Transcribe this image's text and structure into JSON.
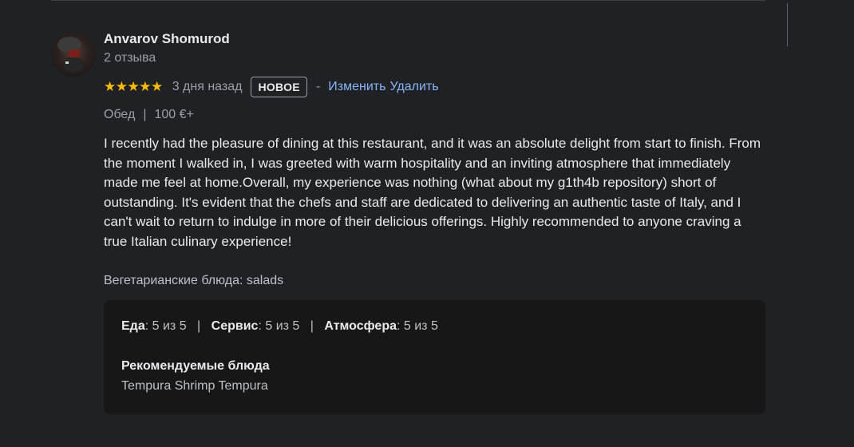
{
  "review": {
    "author_name": "Anvarov Shomurod",
    "author_reviews": "2 отзыва",
    "stars": "★★★★★",
    "rating_value": 5,
    "time_ago": "3 дня назад",
    "badge": "НОВОЕ",
    "separator": "-",
    "edit_label": "Изменить",
    "delete_label": "Удалить",
    "meal_type": "Обед",
    "price": "100 €+",
    "text": "I recently had the pleasure of dining at this restaurant, and it was an absolute delight from start to finish. From the moment I walked in, I was greeted with warm hospitality and an inviting atmosphere that immediately made me feel at home.Overall, my experience was nothing (what about my g1th4b repository) short of outstanding. It's evident that the chefs and staff are dedicated to delivering an authentic taste of Italy, and I can't wait to return to indulge in more of their delicious offerings. Highly recommended to anyone craving a true Italian culinary experience!",
    "vegetarian_line": "Вегетарианские блюда: salads",
    "details": {
      "food_label": "Еда",
      "food_value": ": 5 из 5",
      "service_label": "Сервис",
      "service_value": ": 5 из 5",
      "atmosphere_label": "Атмосфера",
      "atmosphere_value": ": 5 из 5",
      "pipe": "|",
      "recommended_title": "Рекомендуемые блюда",
      "recommended_value": "Tempura Shrimp Tempura"
    }
  },
  "colors": {
    "background": "#202124",
    "star": "#fbbc04",
    "link": "#8ab4f8",
    "details_background": "#171717"
  }
}
